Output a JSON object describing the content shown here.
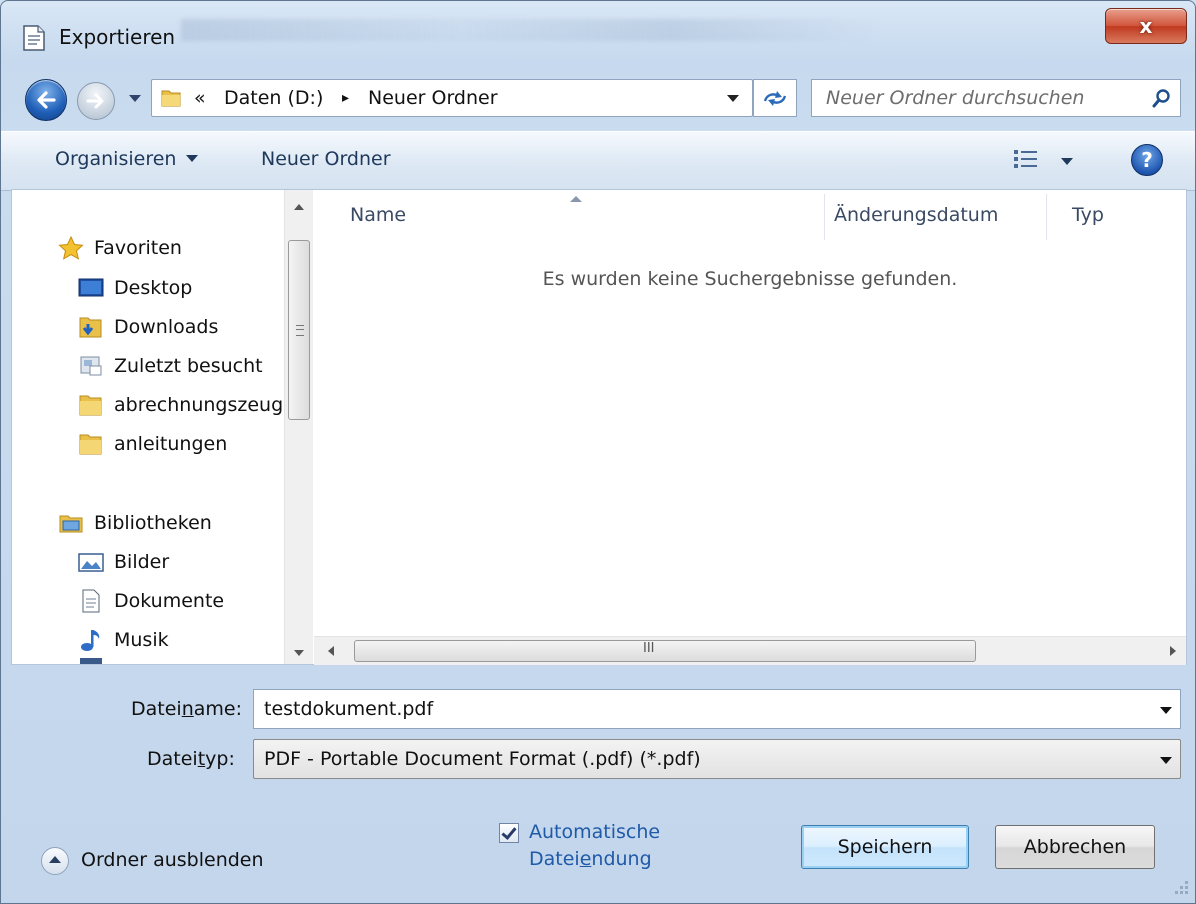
{
  "window": {
    "title": "Exportieren",
    "close_label": "x"
  },
  "address_bar": {
    "overflow": "«",
    "crumbs": [
      "Daten (D:)",
      "Neuer Ordner"
    ],
    "separator": "▸"
  },
  "search": {
    "placeholder": "Neuer Ordner durchsuchen"
  },
  "toolbar": {
    "organize_label": "Organisieren",
    "new_folder_label": "Neuer Ordner",
    "help_label": "?"
  },
  "nav_pane": {
    "favorites_header": "Favoriten",
    "favorites": [
      "Desktop",
      "Downloads",
      "Zuletzt besucht",
      "abrechnungszeug",
      "anleitungen"
    ],
    "libraries_header": "Bibliotheken",
    "libraries": [
      "Bilder",
      "Dokumente",
      "Musik"
    ]
  },
  "file_list": {
    "columns": [
      "Name",
      "Änderungsdatum",
      "Typ"
    ],
    "empty_message": "Es wurden keine Suchergebnisse gefunden.",
    "hscroll_grip": "III"
  },
  "form": {
    "filename_label_pre": "Datei",
    "filename_label_acc": "n",
    "filename_label_post": "ame:",
    "filename_value": "testdokument.pdf",
    "filetype_label_pre": "Datei",
    "filetype_label_acc": "t",
    "filetype_label_post": "yp:",
    "filetype_value": "PDF - Portable Document Format (.pdf) (*.pdf)"
  },
  "footer": {
    "hide_folders_label": "Ordner ausblenden",
    "auto_ext_line1": "Automatische",
    "auto_ext_line2_pre": "Datei",
    "auto_ext_line2_acc": "e",
    "auto_ext_line2_post": "ndung",
    "auto_ext_checked": true,
    "save_label": "Speichern",
    "cancel_label": "Abbrechen"
  }
}
